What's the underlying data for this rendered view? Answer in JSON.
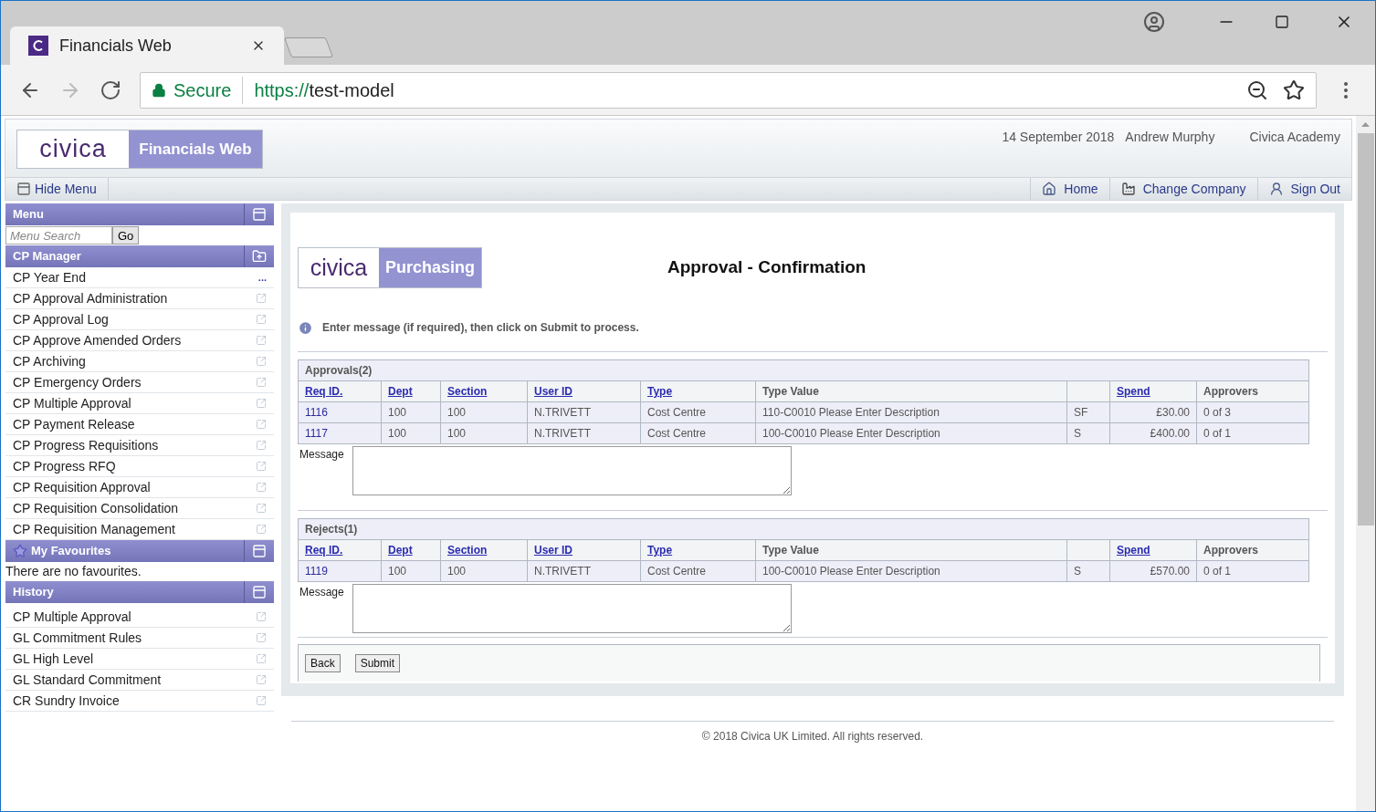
{
  "browser": {
    "tab_title": "Financials Web",
    "secure_label": "Secure",
    "url_scheme": "https://",
    "url_host": "test-model"
  },
  "header": {
    "logo_word": "civica",
    "product": "Financials Web",
    "date": "14 September 2018",
    "user": "Andrew Murphy",
    "company": "Civica Academy",
    "hide_menu": "Hide Menu",
    "nav": [
      {
        "kind": "home",
        "label": "Home"
      },
      {
        "kind": "company",
        "label": "Change Company"
      },
      {
        "kind": "signout",
        "label": "Sign Out"
      }
    ]
  },
  "sidebar": {
    "menu_title": "Menu",
    "search_placeholder": "Menu Search",
    "go": "Go",
    "manager_title": "CP Manager",
    "manager_items": [
      {
        "label": "CP Year End",
        "trailing": "..."
      },
      {
        "label": "CP Approval Administration"
      },
      {
        "label": "CP Approval Log"
      },
      {
        "label": "CP Approve Amended Orders"
      },
      {
        "label": "CP Archiving"
      },
      {
        "label": "CP Emergency Orders"
      },
      {
        "label": "CP Multiple Approval"
      },
      {
        "label": "CP Payment Release"
      },
      {
        "label": "CP Progress Requisitions"
      },
      {
        "label": "CP Progress RFQ"
      },
      {
        "label": "CP Requisition Approval"
      },
      {
        "label": "CP Requisition Consolidation"
      },
      {
        "label": "CP Requisition Management"
      }
    ],
    "favourites_title": "My Favourites",
    "favourites_empty": "There are no favourites.",
    "history_title": "History",
    "history_items": [
      {
        "label": "CP Multiple Approval"
      },
      {
        "label": "GL Commitment Rules"
      },
      {
        "label": "GL High Level"
      },
      {
        "label": "GL Standard Commitment"
      },
      {
        "label": "CR Sundry Invoice"
      }
    ]
  },
  "main": {
    "logo_word": "civica",
    "module": "Purchasing",
    "title": "Approval - Confirmation",
    "info": "Enter message (if required), then click on Submit to process.",
    "sections": [
      {
        "title": "Approvals(2)",
        "message_label": "Message",
        "columns": [
          {
            "label": "Req ID.",
            "sortable": true
          },
          {
            "label": "Dept",
            "sortable": true
          },
          {
            "label": "Section",
            "sortable": true
          },
          {
            "label": "User ID",
            "sortable": true
          },
          {
            "label": "Type",
            "sortable": true
          },
          {
            "label": "Type Value",
            "sortable": false
          },
          {},
          {
            "label": "Spend",
            "sortable": true
          },
          {
            "label": "Approvers",
            "sortable": false
          }
        ],
        "rows": [
          [
            "1116",
            "100",
            "100",
            "N.TRIVETT",
            "Cost Centre",
            "110-C0010 Please Enter Description",
            "SF",
            "£30.00",
            "0 of 3"
          ],
          [
            "1117",
            "100",
            "100",
            "N.TRIVETT",
            "Cost Centre",
            "100-C0010 Please Enter Description",
            "S",
            "£400.00",
            "0 of 1"
          ]
        ]
      },
      {
        "title": "Rejects(1)",
        "message_label": "Message",
        "columns": [
          {
            "label": "Req ID.",
            "sortable": true
          },
          {
            "label": "Dept",
            "sortable": true
          },
          {
            "label": "Section",
            "sortable": true
          },
          {
            "label": "User ID",
            "sortable": true
          },
          {
            "label": "Type",
            "sortable": true
          },
          {
            "label": "Type Value",
            "sortable": false
          },
          {},
          {
            "label": "Spend",
            "sortable": true
          },
          {
            "label": "Approvers",
            "sortable": false
          }
        ],
        "rows": [
          [
            "1119",
            "100",
            "100",
            "N.TRIVETT",
            "Cost Centre",
            "100-C0010 Please Enter Description",
            "S",
            "£570.00",
            "0 of 1"
          ]
        ]
      }
    ],
    "buttons": [
      "Back",
      "Submit"
    ],
    "footer": "© 2018 Civica UK Limited. All rights reserved."
  }
}
